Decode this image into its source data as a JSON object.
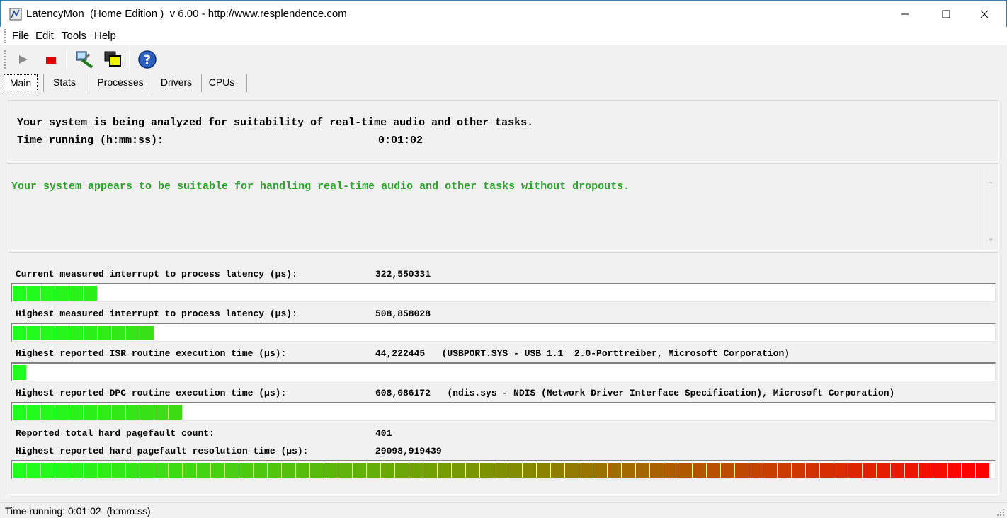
{
  "window": {
    "title": "LatencyMon  (Home Edition )  v 6.00 - http://www.resplendence.com"
  },
  "menu": {
    "items": [
      "File",
      "Edit",
      "Tools",
      "Help"
    ]
  },
  "toolbar": {
    "buttons": [
      "play-icon",
      "stop-icon",
      "driver-settings-icon",
      "copy-windows-icon",
      "help-icon"
    ]
  },
  "tabs": {
    "items": [
      "Main",
      "Stats",
      "Processes",
      "Drivers",
      "CPUs"
    ],
    "active": "Main"
  },
  "analysis": {
    "line1": "Your system is being analyzed for suitability of real-time audio and other tasks.",
    "time_label": "Time running (h:mm:ss):",
    "time_value": "0:01:02"
  },
  "verdict": {
    "text": "Your system appears to be suitable for handling real-time audio and other tasks without dropouts.",
    "color": "#2ea12e"
  },
  "metrics": {
    "current_latency": {
      "label": "Current measured interrupt to process latency (µs):",
      "value": "322,550331",
      "segments": 6
    },
    "highest_latency": {
      "label": "Highest measured interrupt to process latency (µs):",
      "value": "508,858028",
      "segments": 10
    },
    "isr": {
      "label": "Highest reported ISR routine execution time (µs):",
      "value": "44,222445   (USBPORT.SYS - USB 1.1  2.0-Porttreiber, Microsoft Corporation)",
      "segments": 1
    },
    "dpc": {
      "label": "Highest reported DPC routine execution time (µs):",
      "value": "608,086172   (ndis.sys - NDIS (Network Driver Interface Specification), Microsoft Corporation)",
      "segments": 12
    },
    "pagefault_count": {
      "label": "Reported total hard pagefault count:",
      "value": "401"
    },
    "pagefault_time": {
      "label": "Highest reported hard pagefault resolution time (µs):",
      "value": "29098,919439",
      "segments": 69
    },
    "bar_total_segments": 69,
    "gradient_start": "#1eff1e",
    "gradient_mid": "#7f8f00",
    "gradient_end": "#ff0000"
  },
  "statusbar": {
    "text": "Time running: 0:01:02  (h:mm:ss)"
  }
}
